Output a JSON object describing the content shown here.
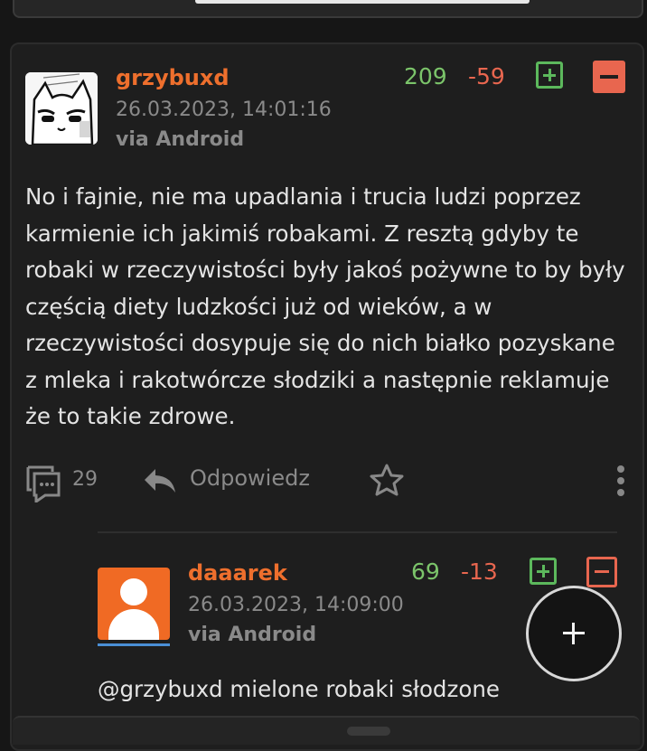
{
  "comment": {
    "author": "grzybuxd",
    "date": "26.03.2023, 14:01:16",
    "via": "via Android",
    "score_plus": "209",
    "score_minus": "-59",
    "body": "No i fajnie, nie ma upadlania i trucia ludzi poprzez karmienie ich jakimiś robakami. Z resztą gdyby te robaki w rzeczywistości były jakoś pożywne to by były częścią diety ludzkości już od wieków, a w rzeczywistości dosypuje się do nich białko pozyskane z mleka i rakotwórcze słodziki a następnie reklamuje że to takie zdrowe.",
    "reply_count": "29",
    "reply_label": "Odpowiedz"
  },
  "reply": {
    "author": "daaarek",
    "date": "26.03.2023, 14:09:00",
    "via": "via Android",
    "score_plus": "69",
    "score_minus": "-13",
    "mention": "@grzybuxd",
    "body": " mielone robaki słodzone"
  },
  "icons": {
    "comments": "comments-icon",
    "reply": "reply-arrow-icon",
    "favorite": "star-icon",
    "more": "more-vertical-icon",
    "fab": "plus-icon"
  },
  "colors": {
    "username": "#ee6f2d",
    "plus": "#7bc46a",
    "minus": "#e8664f",
    "background": "#161616"
  }
}
